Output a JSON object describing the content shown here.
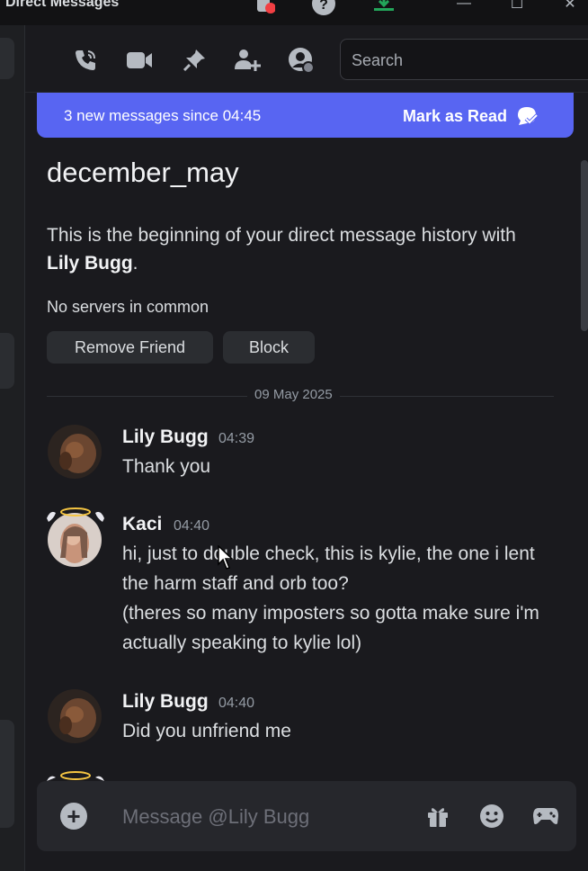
{
  "window": {
    "title": "Direct Messages",
    "controls": {
      "minimize": "—",
      "maximize": "☐",
      "close": "✕"
    }
  },
  "header": {
    "icons": [
      "phone-call-icon",
      "video-call-icon",
      "pin-icon",
      "add-friend-icon",
      "user-profile-icon"
    ],
    "search_placeholder": "Search"
  },
  "banner": {
    "text": "3 new messages since 04:45",
    "action": "Mark as Read"
  },
  "dm": {
    "title": "december_may",
    "intro_prefix": "This is the beginning of your direct message history with ",
    "intro_name": "Lily Bugg",
    "intro_suffix": ".",
    "no_servers": "No servers in common",
    "remove_friend": "Remove Friend",
    "block": "Block",
    "date_divider": "09 May 2025"
  },
  "messages": [
    {
      "author": "Lily Bugg",
      "time": "04:39",
      "lines": [
        "Thank you"
      ]
    },
    {
      "author": "Kaci",
      "time": "04:40",
      "lines": [
        "hi, just to double check, this is kylie, the one i lent the harm staff and orb too?",
        "(theres so many imposters so gotta make sure i'm actually speaking to kylie lol)"
      ]
    },
    {
      "author": "Lily Bugg",
      "time": "04:40",
      "lines": [
        "Did you unfriend me"
      ]
    }
  ],
  "composer": {
    "placeholder": "Message @Lily Bugg",
    "icons": [
      "gift-icon",
      "emoji-icon",
      "game-controller-icon"
    ]
  },
  "colors": {
    "accent": "#5865f2",
    "background": "#1a1a1e",
    "notification_dot": "#f23f43",
    "download": "#23a55a"
  }
}
